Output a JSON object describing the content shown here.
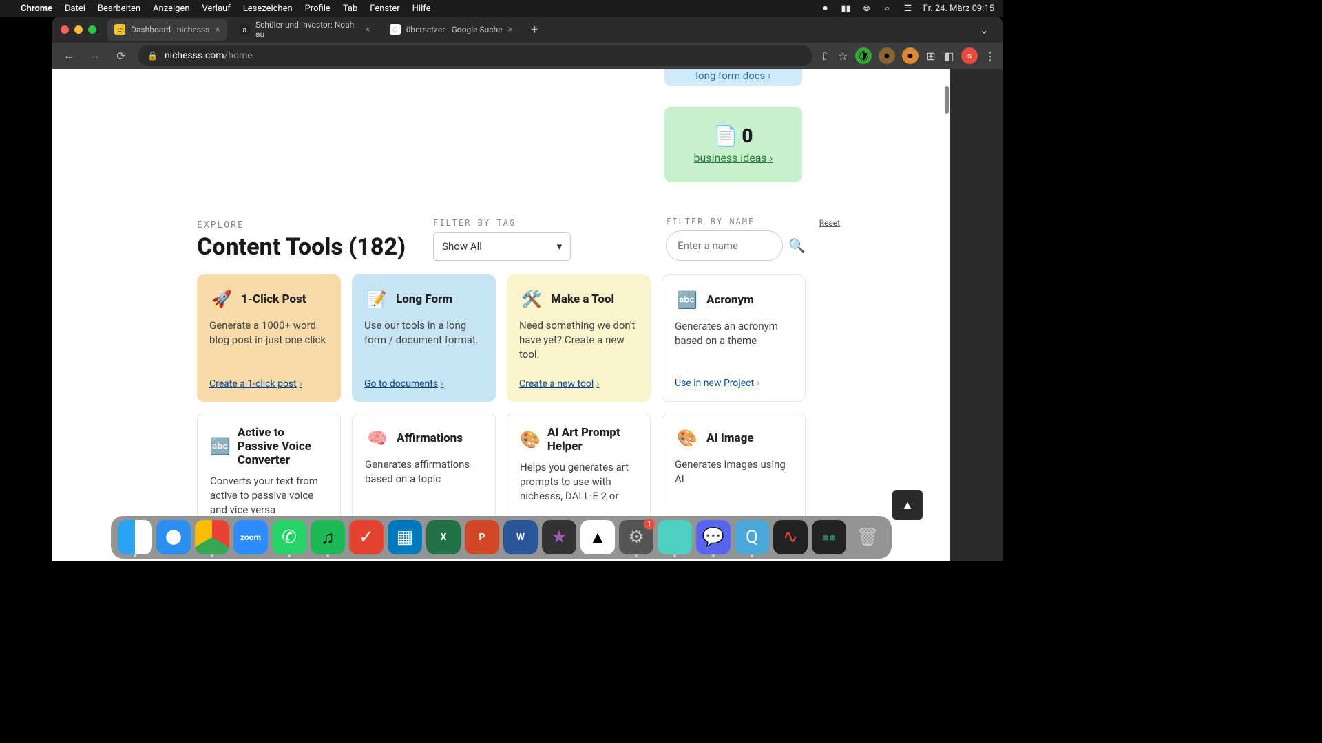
{
  "menubar": {
    "app": "Chrome",
    "items": [
      "Datei",
      "Bearbeiten",
      "Anzeigen",
      "Verlauf",
      "Lesezeichen",
      "Profile",
      "Tab",
      "Fenster",
      "Hilfe"
    ],
    "clock": "Fr. 24. März 09:15"
  },
  "tabs": [
    {
      "title": "Dashboard | nichesss",
      "active": true
    },
    {
      "title": "Schüler und Investor: Noah au",
      "active": false
    },
    {
      "title": "übersetzer - Google Suche",
      "active": false
    }
  ],
  "url": {
    "domain": "nichesss.com",
    "path": "/home"
  },
  "avatar_letter": "s",
  "topcard_blue_link": "long form docs",
  "green_card": {
    "count": "0",
    "link": "business ideas"
  },
  "explore": {
    "eyebrow": "EXPLORE",
    "title": "Content Tools (182)",
    "filter_tag_label": "FILTER BY TAG",
    "filter_tag_value": "Show All",
    "filter_name_label": "FILTER BY NAME",
    "filter_name_placeholder": "Enter a name",
    "reset": "Reset"
  },
  "cards": [
    {
      "icon": "🚀",
      "title": "1-Click Post",
      "desc": "Generate a 1000+ word blog post in just one click",
      "link": "Create a 1-click post",
      "variant": "orange"
    },
    {
      "icon": "📝",
      "title": "Long Form",
      "desc": "Use our tools in a long form / document format.",
      "link": "Go to documents",
      "variant": "blue"
    },
    {
      "icon": "🛠️",
      "title": "Make a Tool",
      "desc": "Need something we don't have yet? Create a new tool.",
      "link": "Create a new tool",
      "variant": "yellow"
    },
    {
      "icon": "🔤",
      "title": "Acronym",
      "desc": "Generates an acronym based on a theme",
      "link": "Use in new Project",
      "variant": "white"
    },
    {
      "icon": "🔤",
      "title": "Active to Passive Voice Converter",
      "desc": "Converts your text from active to passive voice and vice versa",
      "link": "",
      "variant": "white"
    },
    {
      "icon": "🧠",
      "title": "Affirmations",
      "desc": "Generates affirmations based on a topic",
      "link": "",
      "variant": "white"
    },
    {
      "icon": "🎨",
      "title": "AI Art Prompt Helper",
      "desc": "Helps you generates art prompts to use with nichesss, DALL·E 2 or",
      "link": "",
      "variant": "white"
    },
    {
      "icon": "🎨",
      "title": "AI Image",
      "desc": "Generates images using AI",
      "link": "",
      "variant": "white"
    }
  ],
  "dock_badge": "1"
}
